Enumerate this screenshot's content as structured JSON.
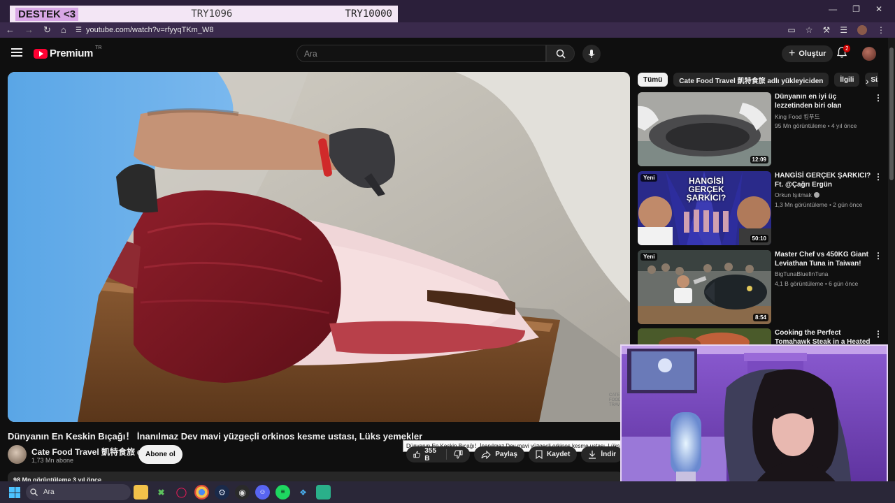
{
  "overlay": {
    "donation_label": "DESTEK <3",
    "donation_current": "TRY1096",
    "donation_goal": "TRY10000"
  },
  "browser": {
    "url": "youtube.com/watch?v=rfyyqTKm_W8"
  },
  "header": {
    "logo_text": "Premium",
    "country": "TR",
    "search_placeholder": "Ara",
    "create_label": "Oluştur",
    "notifications_count": "2"
  },
  "video": {
    "title": "Dünyanın En Keskin Bıçağı！ İnanılmaz Dev mavi yüzgeçli orkinos kesme ustası, Lüks yemekler",
    "tooltip": "Dünyanın En Keskin Bıçağı！İnanılmaz Dev mavi yüzgeçli orkinos kesme ustası, Lüks yemekler",
    "watermark": "CATE FOOD TRAVEL",
    "channel": "Cate Food Travel 凱特食旅",
    "subscribers": "1,73 Mn abone",
    "subscribe_label": "Abone ol",
    "likes": "355 B",
    "share_label": "Paylaş",
    "save_label": "Kaydet",
    "download_label": "İndir",
    "views_partial": "98 Mn görüntüleme  3 yıl önce"
  },
  "chips": [
    "Tümü",
    "Cate Food Travel 凱特食旅 adlı yükleyiciden",
    "İlgili",
    "Size"
  ],
  "recommendations": [
    {
      "title": "Dünyanın en iyi üç lezzetinden biri olan havyarın yapım süreci...",
      "channel": "King Food 킹푸드",
      "meta": "95 Mn görüntüleme • 4 yıl önce",
      "duration": "12:09",
      "tag": "",
      "verified": false
    },
    {
      "title": "HANGİSİ GERÇEK ŞARKICI? Ft. @Çağrı Ergün",
      "channel": "Orkun Işıtmak",
      "meta": "1,3 Mn görüntüleme • 2 gün önce",
      "duration": "50:10",
      "tag": "Yeni",
      "verified": true,
      "thumb_text": "HANGİSİ GERÇEK ŞARKICI?"
    },
    {
      "title": "Master Chef vs 450KG Giant Leviathan Tuna in Taiwan! 職...",
      "channel": "BigTunaBluefinTuna",
      "meta": "4,1 B görüntüleme • 6 gün önce",
      "duration": "8:54",
      "tag": "Yeni",
      "verified": false
    },
    {
      "title": "Cooking the Perfect Tomahawk Steak in a Heated Forest Roc...",
      "channel": "",
      "meta": "",
      "duration": "",
      "tag": "",
      "verified": false
    }
  ],
  "taskbar": {
    "search_placeholder": "Ara"
  }
}
